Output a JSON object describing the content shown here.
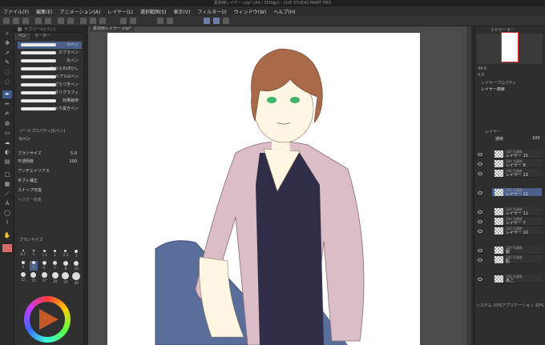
{
  "window": {
    "title": "素材用レイヤー.clip* (A4 / 350dpi) - CLIP STUDIO PAINT PRO"
  },
  "menu": [
    "ファイル(F)",
    "編集(E)",
    "アニメーション(A)",
    "レイヤー(L)",
    "選択範囲(S)",
    "表示(V)",
    "フィルター(I)",
    "ウィンドウ(W)",
    "ヘルプ(H)"
  ],
  "left_panel": {
    "subtool_title": "サブツール[ペン]",
    "tabs": [
      "ペン",
      "マーカー"
    ],
    "brushes": [
      "Gペン",
      "カブラペン",
      "丸ペン",
      "ひかえめぼかし",
      "リアルGペン",
      "ざらつきペン",
      "カリグラフィ",
      "効果線用",
      "入り抜きペン"
    ],
    "tool_prop_title": "ツールプロパティ[Gペン]",
    "tool_prop_name": "Gペン",
    "props": [
      {
        "label": "ブラシサイズ",
        "value": "5.0"
      },
      {
        "label": "不透明度",
        "value": "100"
      },
      {
        "label": "アンチエイリアス",
        "value": ""
      },
      {
        "label": "手ブレ補正",
        "value": ""
      },
      {
        "label": "ベクター吸着",
        "value": ""
      }
    ],
    "snap_label": "スナップ可能",
    "size_panel_title": "ブラシサイズ",
    "sizes_row1": [
      "0.7",
      "1",
      "1.5",
      "2",
      "2.5",
      "3"
    ],
    "sizes_row2": [
      "4",
      "5",
      "6",
      "7",
      "8",
      "10"
    ],
    "sizes_row3": [
      "12",
      "15",
      "17",
      "20",
      "25",
      "30"
    ]
  },
  "canvas": {
    "tab": "素材用レイヤー.clip*"
  },
  "right_panel": {
    "navigator_title": "ナビゲーター",
    "zoom": "44.6",
    "rotate": "0.0",
    "layer_prop_title": "レイヤープロパティ",
    "layer_search_title": "レイヤー検索",
    "layer_title": "レイヤー",
    "blend_mode": "通常",
    "opacity": "100",
    "layers": [
      {
        "mode": "100 %通常",
        "name": "レイヤー 15"
      },
      {
        "mode": "100 %通常",
        "name": "レイヤー 8"
      },
      {
        "mode": "100 %通常",
        "name": "レイヤー 13"
      },
      {
        "mode": "100 %通常",
        "name": "レイヤー 12"
      },
      {
        "mode": "100 %通常",
        "name": "レイヤー 11"
      },
      {
        "mode": "100 %通常",
        "name": "レイヤー 7"
      },
      {
        "mode": "100 %通常",
        "name": "レイヤー 10"
      },
      {
        "mode": "100 %通常",
        "name": "服"
      },
      {
        "mode": "100 %通常",
        "name": "肌"
      },
      {
        "mode": "100 %通常",
        "name": "あご"
      }
    ],
    "footer1": "システム 33%",
    "footer2": "アプリケーション 33%"
  },
  "colors": {
    "accent": "#4a5f8a",
    "main_color": "#d46a6a"
  }
}
